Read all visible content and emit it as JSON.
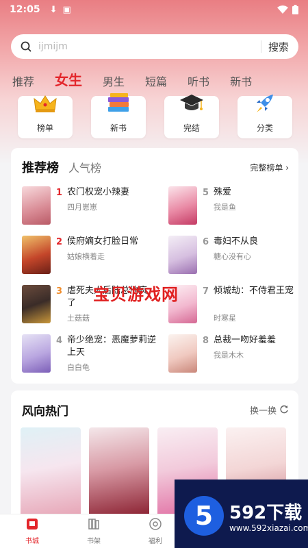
{
  "status_bar": {
    "time": "12:05"
  },
  "search": {
    "placeholder": "ijmijm",
    "button": "搜索"
  },
  "tabs": [
    "推荐",
    "女生",
    "男生",
    "短篇",
    "听书",
    "新书"
  ],
  "active_tab": "女生",
  "categories": [
    {
      "label": "榜单",
      "icon": "crown-icon"
    },
    {
      "label": "新书",
      "icon": "books-stack-icon"
    },
    {
      "label": "完结",
      "icon": "graduation-cap-icon"
    },
    {
      "label": "分类",
      "icon": "rocket-icon"
    }
  ],
  "ranking": {
    "tab_active": "推荐榜",
    "tab_other": "人气榜",
    "more": "完整榜单",
    "books": [
      {
        "rank": "1",
        "title": "农门权宠小辣妻",
        "author": "四月崽崽"
      },
      {
        "rank": "2",
        "title": "侯府嫡女打脸日常",
        "author": "姑娘横着走"
      },
      {
        "rank": "3",
        "title": "虐死夫人后陆总他疯了",
        "author": "土菇菇"
      },
      {
        "rank": "4",
        "title": "帝少绝宠：恶魔萝莉逆上天",
        "author": "白白龟"
      },
      {
        "rank": "5",
        "title": "殊爱",
        "author": "我是鱼"
      },
      {
        "rank": "6",
        "title": "毒妇不从良",
        "author": "糖心没有心"
      },
      {
        "rank": "7",
        "title": "倾城劫：不侍君王宠",
        "author": "时寒星"
      },
      {
        "rank": "8",
        "title": "总裁一吻好羞羞",
        "author": "我是木木"
      }
    ]
  },
  "watermark": "宝贝游戏网",
  "hot": {
    "title": "风向热门",
    "more": "换一换"
  },
  "bottom_nav": [
    {
      "label": "书城",
      "icon": "bookstore-icon"
    },
    {
      "label": "书架",
      "icon": "bookshelf-icon"
    },
    {
      "label": "福利",
      "icon": "welfare-icon"
    }
  ],
  "promo": {
    "badge": "5",
    "brand": "592下载",
    "url": "www.592xiazai.com"
  },
  "colors": {
    "accent": "#e3262b",
    "header_gradient_top": "#e97e83"
  }
}
